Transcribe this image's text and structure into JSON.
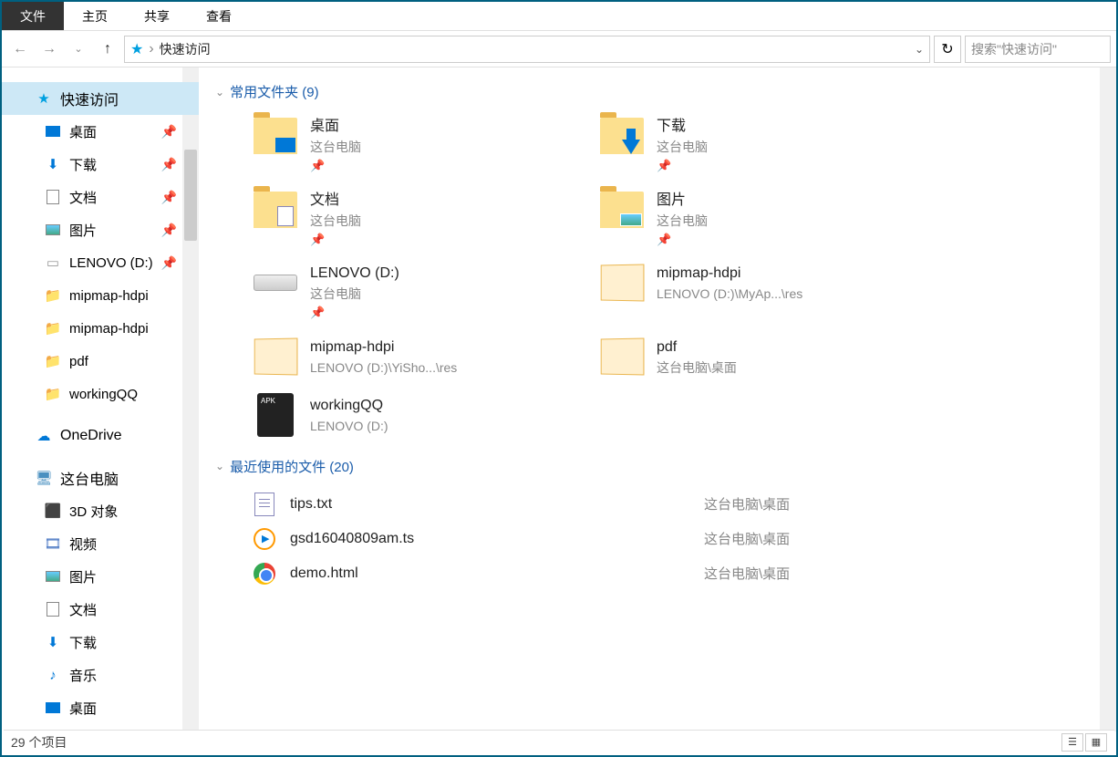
{
  "ribbon": {
    "tabs": [
      "文件",
      "主页",
      "共享",
      "查看"
    ],
    "active_index": 0
  },
  "nav": {
    "address_prefix": "›",
    "address": "快速访问",
    "search_placeholder": "搜索\"快速访问\""
  },
  "sidebar": {
    "quick_access": {
      "label": "快速访问",
      "items": [
        {
          "label": "桌面",
          "pinned": true,
          "icon": "desktop"
        },
        {
          "label": "下载",
          "pinned": true,
          "icon": "download"
        },
        {
          "label": "文档",
          "pinned": true,
          "icon": "document"
        },
        {
          "label": "图片",
          "pinned": true,
          "icon": "picture"
        },
        {
          "label": "LENOVO (D:)",
          "pinned": true,
          "icon": "disk"
        },
        {
          "label": "mipmap-hdpi",
          "pinned": false,
          "icon": "folder"
        },
        {
          "label": "mipmap-hdpi",
          "pinned": false,
          "icon": "folder"
        },
        {
          "label": "pdf",
          "pinned": false,
          "icon": "folder"
        },
        {
          "label": "workingQQ",
          "pinned": false,
          "icon": "folder"
        }
      ]
    },
    "onedrive": "OneDrive",
    "this_pc": {
      "label": "这台电脑",
      "items": [
        {
          "label": "3D 对象",
          "icon": "cube"
        },
        {
          "label": "视频",
          "icon": "video"
        },
        {
          "label": "图片",
          "icon": "picture"
        },
        {
          "label": "文档",
          "icon": "document"
        },
        {
          "label": "下载",
          "icon": "download"
        },
        {
          "label": "音乐",
          "icon": "music"
        },
        {
          "label": "桌面",
          "icon": "desktop"
        }
      ]
    }
  },
  "content": {
    "frequent": {
      "header": "常用文件夹 (9)",
      "tiles": [
        {
          "name": "桌面",
          "sub": "这台电脑",
          "pinned": true,
          "overlay": "blue"
        },
        {
          "name": "下载",
          "sub": "这台电脑",
          "pinned": true,
          "overlay": "download"
        },
        {
          "name": "文档",
          "sub": "这台电脑",
          "pinned": true,
          "overlay": "doc"
        },
        {
          "name": "图片",
          "sub": "这台电脑",
          "pinned": true,
          "overlay": "img"
        },
        {
          "name": "LENOVO (D:)",
          "sub": "这台电脑",
          "pinned": true,
          "overlay": "disk"
        },
        {
          "name": "mipmap-hdpi",
          "sub": "LENOVO (D:)\\MyAp...\\res",
          "pinned": false,
          "overlay": "open"
        },
        {
          "name": "mipmap-hdpi",
          "sub": "LENOVO (D:)\\YiSho...\\res",
          "pinned": false,
          "overlay": "open"
        },
        {
          "name": "pdf",
          "sub": "这台电脑\\桌面",
          "pinned": false,
          "overlay": "open"
        },
        {
          "name": "workingQQ",
          "sub": "LENOVO (D:)",
          "pinned": false,
          "overlay": "apk"
        }
      ]
    },
    "recent": {
      "header": "最近使用的文件 (20)",
      "rows": [
        {
          "name": "tips.txt",
          "path": "这台电脑\\桌面",
          "icon": "txt"
        },
        {
          "name": "gsd16040809am.ts",
          "path": "这台电脑\\桌面",
          "icon": "wmp"
        },
        {
          "name": "demo.html",
          "path": "这台电脑\\桌面",
          "icon": "chrome"
        }
      ]
    }
  },
  "status": {
    "text": "29 个项目"
  }
}
